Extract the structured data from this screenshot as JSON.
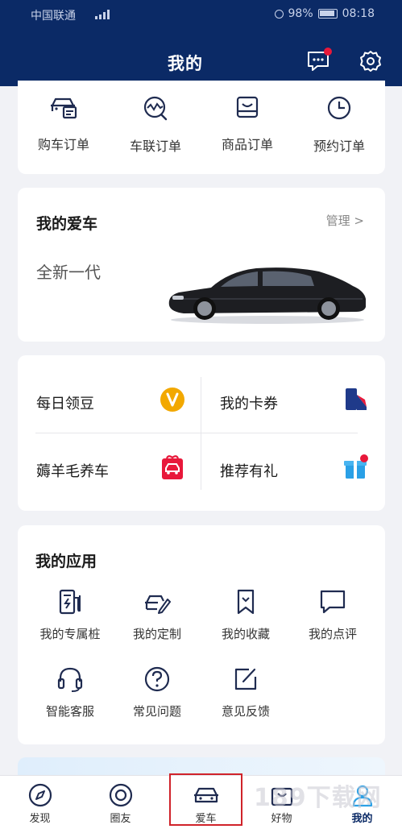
{
  "status_bar": {
    "carrier": "中国联通",
    "battery": "98%",
    "time": "08:18"
  },
  "header": {
    "title": "我的",
    "message_badge_color": "#e8183a"
  },
  "orders": [
    {
      "label": "购车订单",
      "icon": "car-order-icon"
    },
    {
      "label": "车联订单",
      "icon": "connected-car-order-icon"
    },
    {
      "label": "商品订单",
      "icon": "goods-order-icon"
    },
    {
      "label": "预约订单",
      "icon": "clock-icon"
    }
  ],
  "my_car": {
    "title": "我的爱车",
    "manage": "管理 >",
    "model": "全新一代"
  },
  "perks": [
    {
      "label": "每日领豆",
      "icon": "coin-icon"
    },
    {
      "label": "我的卡券",
      "icon": "coupon-icon"
    },
    {
      "label": "薅羊毛养车",
      "icon": "gift-car-icon"
    },
    {
      "label": "推荐有礼",
      "icon": "gift-box-icon"
    }
  ],
  "apps": {
    "title": "我的应用",
    "items": [
      {
        "label": "我的专属桩",
        "icon": "charging-pile-icon"
      },
      {
        "label": "我的定制",
        "icon": "custom-car-icon"
      },
      {
        "label": "我的收藏",
        "icon": "bookmark-icon"
      },
      {
        "label": "我的点评",
        "icon": "comment-icon"
      },
      {
        "label": "智能客服",
        "icon": "headset-icon"
      },
      {
        "label": "常见问题",
        "icon": "question-icon"
      },
      {
        "label": "意见反馈",
        "icon": "feedback-icon"
      }
    ]
  },
  "tabbar": {
    "items": [
      {
        "label": "发现",
        "icon": "compass-icon"
      },
      {
        "label": "圈友",
        "icon": "circle-icon"
      },
      {
        "label": "爱车",
        "icon": "car-icon"
      },
      {
        "label": "好物",
        "icon": "shop-icon"
      },
      {
        "label": "我的",
        "icon": "user-icon"
      }
    ],
    "active_index": 4,
    "highlighted_index": 2
  },
  "watermark": "189下载网",
  "colors": {
    "header_bg": "#0b2a66",
    "accent_yellow": "#f2a800",
    "accent_red": "#e8183a",
    "accent_navy": "#1f3a8a",
    "accent_blue": "#2aa0e6"
  }
}
